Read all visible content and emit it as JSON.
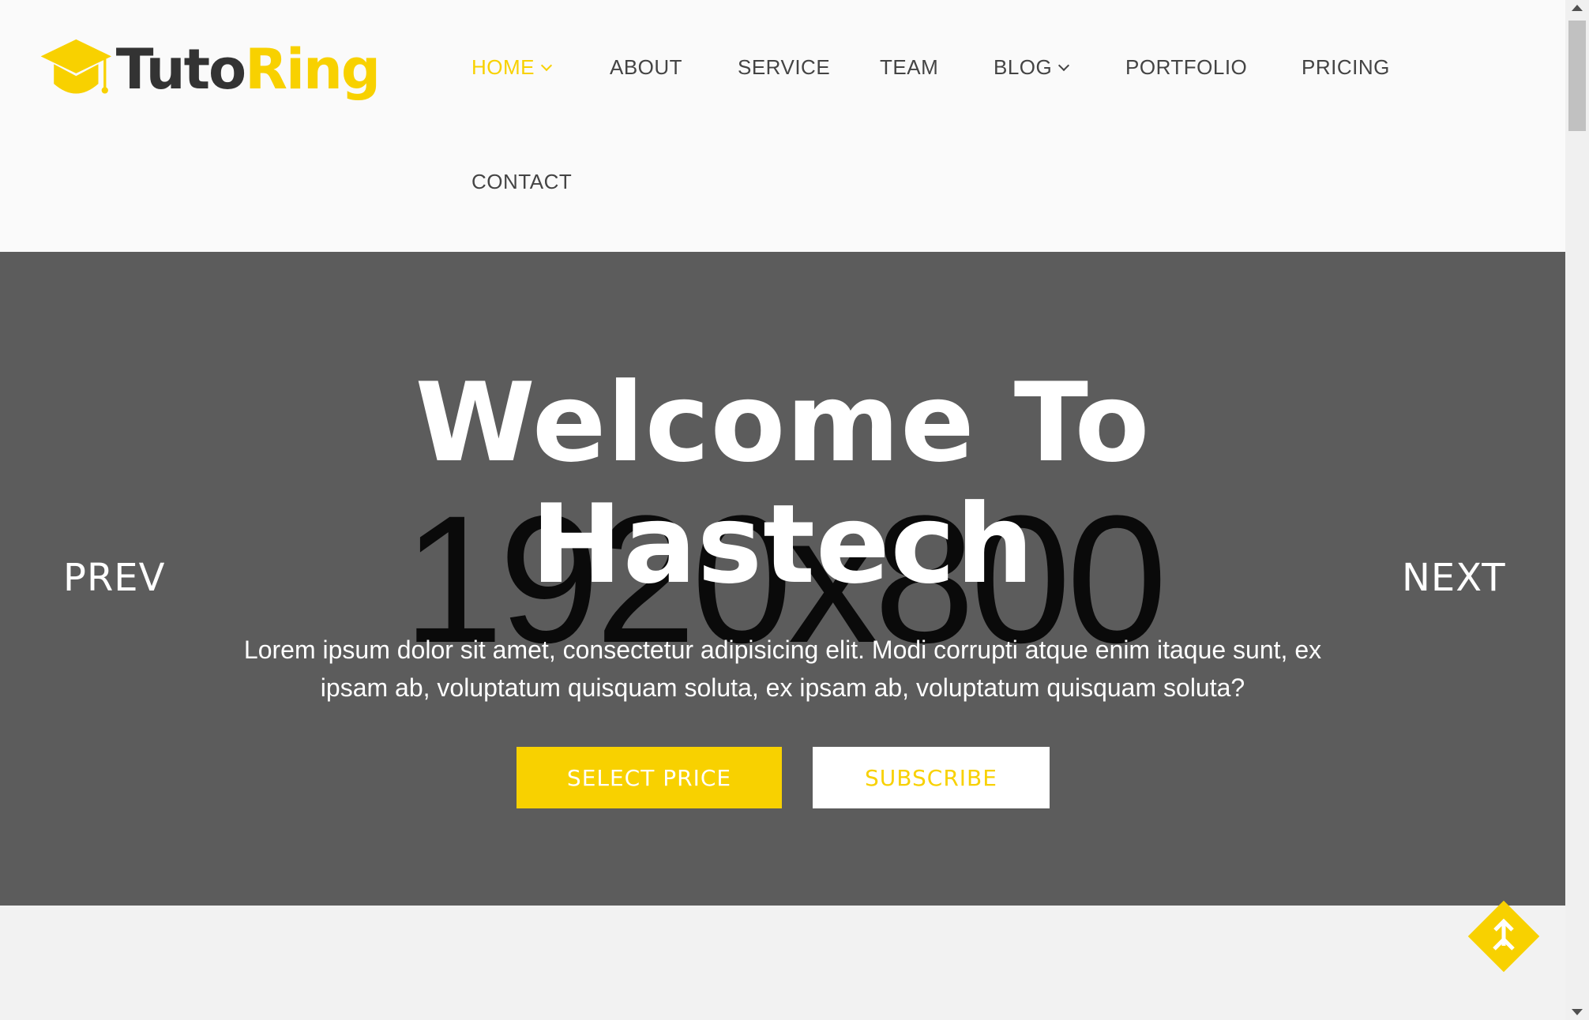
{
  "brand": {
    "name_dark": "Tuto",
    "name_accent": "Ring",
    "accent_color": "#f8d100",
    "dark_color": "#333333"
  },
  "nav": {
    "items": [
      {
        "label": "HOME",
        "active": true,
        "dropdown": true
      },
      {
        "label": "ABOUT",
        "active": false,
        "dropdown": false
      },
      {
        "label": "SERVICE",
        "active": false,
        "dropdown": false
      },
      {
        "label": "TEAM",
        "active": false,
        "dropdown": false
      },
      {
        "label": "BLOG",
        "active": false,
        "dropdown": true
      },
      {
        "label": "PORTFOLIO",
        "active": false,
        "dropdown": false
      },
      {
        "label": "PRICING",
        "active": false,
        "dropdown": false
      },
      {
        "label": "CONTACT",
        "active": false,
        "dropdown": false
      }
    ]
  },
  "hero": {
    "placeholder": "1920x800",
    "title_line1": "Welcome To",
    "title_line2": "Hastech",
    "description_line1": "Lorem ipsum dolor sit amet, consectetur adipisicing elit. Modi corrupti atque enim itaque sunt, ex",
    "description_line2": "ipsam ab, voluptatum quisquam soluta, ex ipsam ab, voluptatum quisquam soluta?",
    "primary_button": "SELECT PRICE",
    "secondary_button": "SUBSCRIBE",
    "prev_label": "PREV",
    "next_label": "NEXT",
    "background_color": "#5c5c5c"
  },
  "scroll_top": {
    "icon": "arrow-up-icon"
  }
}
